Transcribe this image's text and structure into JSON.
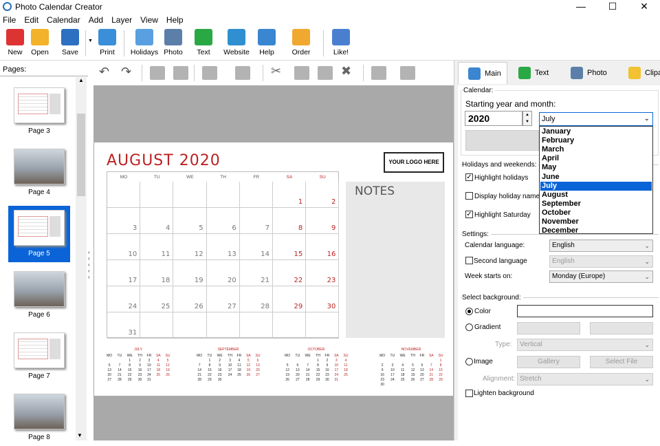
{
  "window": {
    "title": "Photo Calendar Creator",
    "min": "—",
    "max": "☐",
    "close": "✕"
  },
  "menu": [
    "File",
    "Edit",
    "Calendar",
    "Add",
    "Layer",
    "View",
    "Help"
  ],
  "toolbar": [
    {
      "label": "New",
      "icon": "new-icon",
      "color": "#d33"
    },
    {
      "label": "Open",
      "icon": "folder-icon",
      "color": "#f2b22a"
    },
    {
      "label": "Save",
      "icon": "floppy-icon",
      "color": "#2d6fc0"
    },
    {
      "label": "Print",
      "icon": "printer-icon",
      "color": "#3a8fd8"
    },
    {
      "label": "Holidays",
      "icon": "calendar-icon",
      "color": "#5aa0e0"
    },
    {
      "label": "Photo",
      "icon": "camera-icon",
      "color": "#5b7fa8"
    },
    {
      "label": "Text",
      "icon": "text-a-icon",
      "color": "#2aa844"
    },
    {
      "label": "Website",
      "icon": "globe-icon",
      "color": "#2f8fd0"
    },
    {
      "label": "Help",
      "icon": "help-book-icon",
      "color": "#3a86d0"
    },
    {
      "label": "Order",
      "icon": "shopping-bag-icon",
      "color": "#f0a830"
    },
    {
      "label": "Like!",
      "icon": "thumbs-up-icon",
      "color": "#4a7fd0"
    }
  ],
  "pages": {
    "label": "Pages:",
    "items": [
      {
        "label": "Page 3",
        "type": "calendar"
      },
      {
        "label": "Page 4",
        "type": "photo"
      },
      {
        "label": "Page 5",
        "type": "calendar",
        "selected": true
      },
      {
        "label": "Page 6",
        "type": "photo"
      },
      {
        "label": "Page 7",
        "type": "calendar"
      },
      {
        "label": "Page 8",
        "type": "photo"
      }
    ]
  },
  "calendar": {
    "title": "AUGUST 2020",
    "logo": "YOUR LOGO HERE",
    "notes": "NOTES",
    "day_headers": [
      "MO",
      "TU",
      "WE",
      "TH",
      "FR",
      "SA",
      "SU"
    ],
    "weeks": [
      [
        "",
        "",
        "",
        "",
        "",
        "1",
        "2"
      ],
      [
        "3",
        "4",
        "5",
        "6",
        "7",
        "8",
        "9"
      ],
      [
        "10",
        "11",
        "12",
        "13",
        "14",
        "15",
        "16"
      ],
      [
        "17",
        "18",
        "19",
        "20",
        "21",
        "22",
        "23"
      ],
      [
        "24",
        "25",
        "26",
        "27",
        "28",
        "29",
        "30"
      ],
      [
        "31",
        "",
        "",
        "",
        "",
        "",
        ""
      ]
    ],
    "mini": [
      {
        "name": "JULY",
        "weeks": [
          [
            "",
            "",
            "1",
            "2",
            "3",
            "4",
            "5"
          ],
          [
            "6",
            "7",
            "8",
            "9",
            "10",
            "11",
            "12"
          ],
          [
            "13",
            "14",
            "15",
            "16",
            "17",
            "18",
            "19"
          ],
          [
            "20",
            "21",
            "22",
            "23",
            "24",
            "25",
            "26"
          ],
          [
            "27",
            "28",
            "29",
            "30",
            "31",
            "",
            ""
          ]
        ]
      },
      {
        "name": "SEPTEMBER",
        "weeks": [
          [
            "",
            "1",
            "2",
            "3",
            "4",
            "5",
            "6"
          ],
          [
            "7",
            "8",
            "9",
            "10",
            "11",
            "12",
            "13"
          ],
          [
            "14",
            "15",
            "16",
            "17",
            "18",
            "19",
            "20"
          ],
          [
            "21",
            "22",
            "23",
            "24",
            "25",
            "26",
            "27"
          ],
          [
            "28",
            "29",
            "30",
            "",
            "",
            "",
            ""
          ]
        ]
      },
      {
        "name": "OCTOBER",
        "weeks": [
          [
            "",
            "",
            "",
            "1",
            "2",
            "3",
            "4"
          ],
          [
            "5",
            "6",
            "7",
            "8",
            "9",
            "10",
            "11"
          ],
          [
            "12",
            "13",
            "14",
            "15",
            "16",
            "17",
            "18"
          ],
          [
            "19",
            "20",
            "21",
            "22",
            "23",
            "24",
            "25"
          ],
          [
            "26",
            "27",
            "28",
            "29",
            "30",
            "31",
            ""
          ]
        ]
      },
      {
        "name": "NOVEMBER",
        "weeks": [
          [
            "",
            "",
            "",
            "",
            "",
            "",
            "1"
          ],
          [
            "2",
            "3",
            "4",
            "5",
            "6",
            "7",
            "8"
          ],
          [
            "9",
            "10",
            "11",
            "12",
            "13",
            "14",
            "15"
          ],
          [
            "16",
            "17",
            "18",
            "19",
            "20",
            "21",
            "22"
          ],
          [
            "23",
            "24",
            "25",
            "26",
            "27",
            "28",
            "29"
          ],
          [
            "30",
            "",
            "",
            "",
            "",
            "",
            ""
          ]
        ]
      }
    ]
  },
  "tabs": [
    {
      "label": "Main",
      "icon": "calendar-tab-icon"
    },
    {
      "label": "Text",
      "icon": "text-tab-icon"
    },
    {
      "label": "Photo",
      "icon": "photo-tab-icon"
    },
    {
      "label": "Clipart",
      "icon": "star-icon"
    }
  ],
  "panel": {
    "calendar_group": "Calendar:",
    "start_label": "Starting year and month:",
    "year": "2020",
    "month": "July",
    "months": [
      "January",
      "February",
      "March",
      "April",
      "May",
      "June",
      "July",
      "August",
      "September",
      "October",
      "November",
      "December"
    ],
    "holidays_group": "Holidays and weekends:",
    "highlight_holidays": "Highlight holidays",
    "display_holiday_names": "Display holiday names",
    "highlight_saturday": "Highlight Saturday",
    "settings_group": "Settings:",
    "calendar_language_label": "Calendar language:",
    "calendar_language": "English",
    "second_language_label": "Second language",
    "second_language": "English",
    "week_starts_label": "Week starts on:",
    "week_starts": "Monday (Europe)",
    "background_group": "Select background:",
    "color_label": "Color",
    "gradient_label": "Gradient",
    "type_label": "Type:",
    "type_value": "Vertical",
    "image_label": "Image",
    "gallery_btn": "Gallery",
    "select_file_btn": "Select File",
    "alignment_label": "Alignment:",
    "alignment_value": "Stretch",
    "lighten_label": "Lighten background"
  }
}
